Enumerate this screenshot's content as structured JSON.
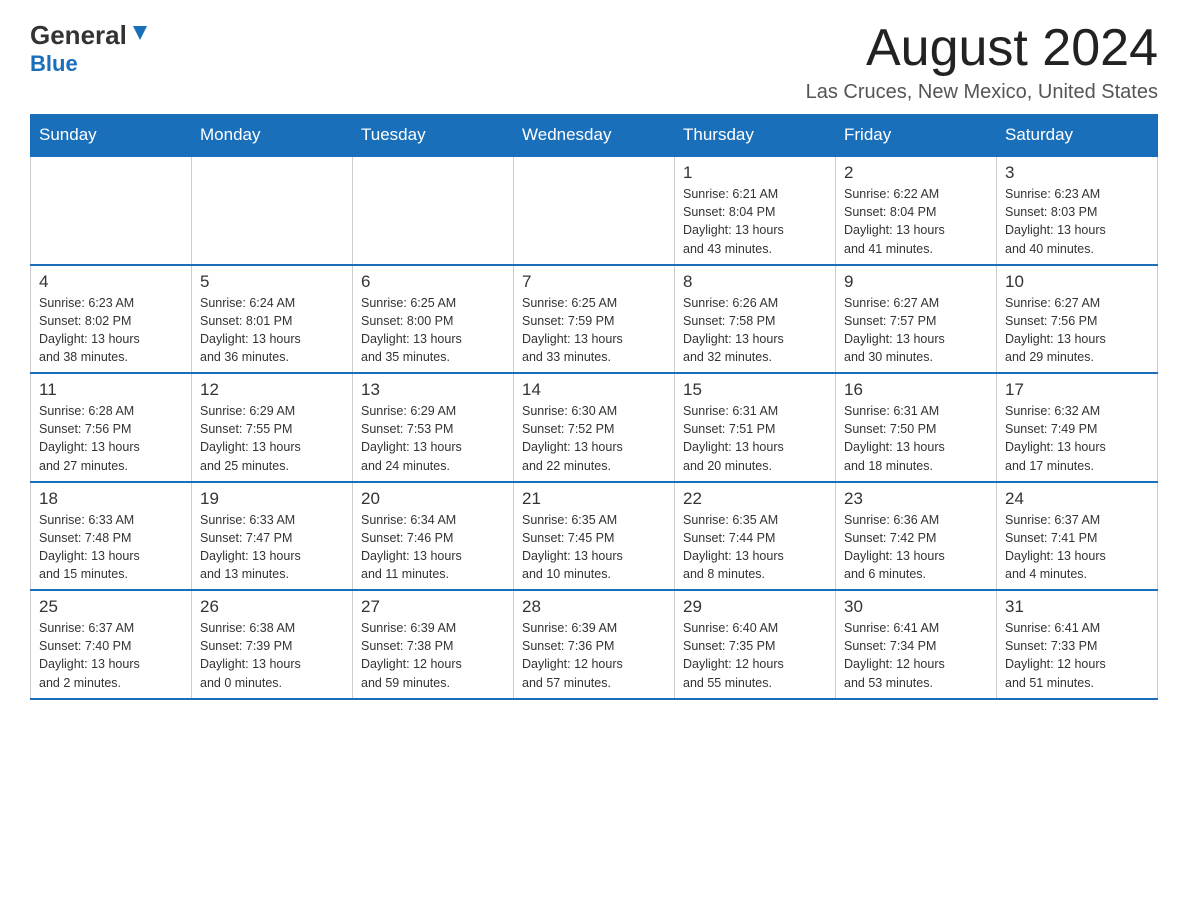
{
  "header": {
    "logo_general": "General",
    "logo_blue": "Blue",
    "month": "August 2024",
    "location": "Las Cruces, New Mexico, United States"
  },
  "weekdays": [
    "Sunday",
    "Monday",
    "Tuesday",
    "Wednesday",
    "Thursday",
    "Friday",
    "Saturday"
  ],
  "weeks": [
    [
      {
        "day": "",
        "info": ""
      },
      {
        "day": "",
        "info": ""
      },
      {
        "day": "",
        "info": ""
      },
      {
        "day": "",
        "info": ""
      },
      {
        "day": "1",
        "info": "Sunrise: 6:21 AM\nSunset: 8:04 PM\nDaylight: 13 hours\nand 43 minutes."
      },
      {
        "day": "2",
        "info": "Sunrise: 6:22 AM\nSunset: 8:04 PM\nDaylight: 13 hours\nand 41 minutes."
      },
      {
        "day": "3",
        "info": "Sunrise: 6:23 AM\nSunset: 8:03 PM\nDaylight: 13 hours\nand 40 minutes."
      }
    ],
    [
      {
        "day": "4",
        "info": "Sunrise: 6:23 AM\nSunset: 8:02 PM\nDaylight: 13 hours\nand 38 minutes."
      },
      {
        "day": "5",
        "info": "Sunrise: 6:24 AM\nSunset: 8:01 PM\nDaylight: 13 hours\nand 36 minutes."
      },
      {
        "day": "6",
        "info": "Sunrise: 6:25 AM\nSunset: 8:00 PM\nDaylight: 13 hours\nand 35 minutes."
      },
      {
        "day": "7",
        "info": "Sunrise: 6:25 AM\nSunset: 7:59 PM\nDaylight: 13 hours\nand 33 minutes."
      },
      {
        "day": "8",
        "info": "Sunrise: 6:26 AM\nSunset: 7:58 PM\nDaylight: 13 hours\nand 32 minutes."
      },
      {
        "day": "9",
        "info": "Sunrise: 6:27 AM\nSunset: 7:57 PM\nDaylight: 13 hours\nand 30 minutes."
      },
      {
        "day": "10",
        "info": "Sunrise: 6:27 AM\nSunset: 7:56 PM\nDaylight: 13 hours\nand 29 minutes."
      }
    ],
    [
      {
        "day": "11",
        "info": "Sunrise: 6:28 AM\nSunset: 7:56 PM\nDaylight: 13 hours\nand 27 minutes."
      },
      {
        "day": "12",
        "info": "Sunrise: 6:29 AM\nSunset: 7:55 PM\nDaylight: 13 hours\nand 25 minutes."
      },
      {
        "day": "13",
        "info": "Sunrise: 6:29 AM\nSunset: 7:53 PM\nDaylight: 13 hours\nand 24 minutes."
      },
      {
        "day": "14",
        "info": "Sunrise: 6:30 AM\nSunset: 7:52 PM\nDaylight: 13 hours\nand 22 minutes."
      },
      {
        "day": "15",
        "info": "Sunrise: 6:31 AM\nSunset: 7:51 PM\nDaylight: 13 hours\nand 20 minutes."
      },
      {
        "day": "16",
        "info": "Sunrise: 6:31 AM\nSunset: 7:50 PM\nDaylight: 13 hours\nand 18 minutes."
      },
      {
        "day": "17",
        "info": "Sunrise: 6:32 AM\nSunset: 7:49 PM\nDaylight: 13 hours\nand 17 minutes."
      }
    ],
    [
      {
        "day": "18",
        "info": "Sunrise: 6:33 AM\nSunset: 7:48 PM\nDaylight: 13 hours\nand 15 minutes."
      },
      {
        "day": "19",
        "info": "Sunrise: 6:33 AM\nSunset: 7:47 PM\nDaylight: 13 hours\nand 13 minutes."
      },
      {
        "day": "20",
        "info": "Sunrise: 6:34 AM\nSunset: 7:46 PM\nDaylight: 13 hours\nand 11 minutes."
      },
      {
        "day": "21",
        "info": "Sunrise: 6:35 AM\nSunset: 7:45 PM\nDaylight: 13 hours\nand 10 minutes."
      },
      {
        "day": "22",
        "info": "Sunrise: 6:35 AM\nSunset: 7:44 PM\nDaylight: 13 hours\nand 8 minutes."
      },
      {
        "day": "23",
        "info": "Sunrise: 6:36 AM\nSunset: 7:42 PM\nDaylight: 13 hours\nand 6 minutes."
      },
      {
        "day": "24",
        "info": "Sunrise: 6:37 AM\nSunset: 7:41 PM\nDaylight: 13 hours\nand 4 minutes."
      }
    ],
    [
      {
        "day": "25",
        "info": "Sunrise: 6:37 AM\nSunset: 7:40 PM\nDaylight: 13 hours\nand 2 minutes."
      },
      {
        "day": "26",
        "info": "Sunrise: 6:38 AM\nSunset: 7:39 PM\nDaylight: 13 hours\nand 0 minutes."
      },
      {
        "day": "27",
        "info": "Sunrise: 6:39 AM\nSunset: 7:38 PM\nDaylight: 12 hours\nand 59 minutes."
      },
      {
        "day": "28",
        "info": "Sunrise: 6:39 AM\nSunset: 7:36 PM\nDaylight: 12 hours\nand 57 minutes."
      },
      {
        "day": "29",
        "info": "Sunrise: 6:40 AM\nSunset: 7:35 PM\nDaylight: 12 hours\nand 55 minutes."
      },
      {
        "day": "30",
        "info": "Sunrise: 6:41 AM\nSunset: 7:34 PM\nDaylight: 12 hours\nand 53 minutes."
      },
      {
        "day": "31",
        "info": "Sunrise: 6:41 AM\nSunset: 7:33 PM\nDaylight: 12 hours\nand 51 minutes."
      }
    ]
  ]
}
